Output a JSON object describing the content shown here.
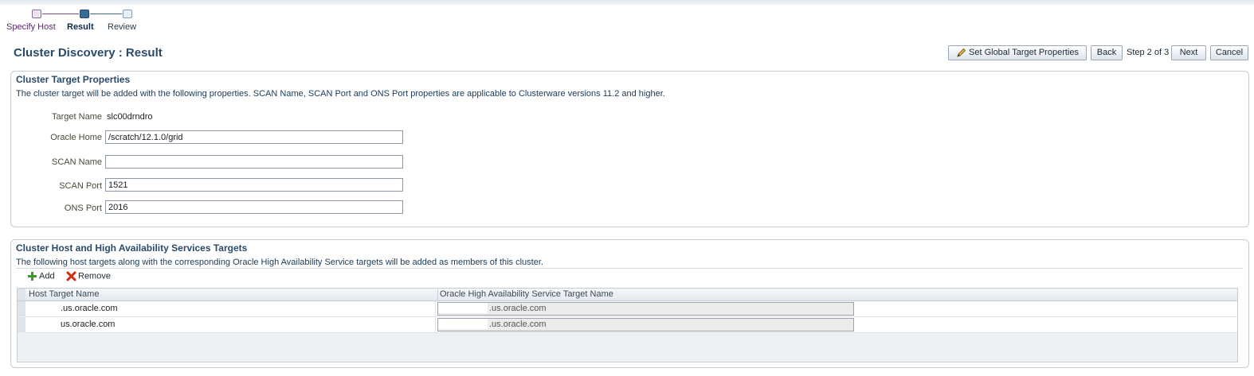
{
  "train": {
    "steps": [
      {
        "label": "Specify Host"
      },
      {
        "label": "Result"
      },
      {
        "label": "Review"
      }
    ]
  },
  "page": {
    "title": "Cluster Discovery : Result"
  },
  "toolbar": {
    "set_global_label": "Set Global Target Properties",
    "back_label": "Back",
    "step_text": "Step 2 of 3",
    "next_label": "Next",
    "cancel_label": "Cancel"
  },
  "cluster_target": {
    "heading": "Cluster Target Properties",
    "description": "The cluster target will be added with the following properties. SCAN Name, SCAN Port and ONS Port properties are applicable to Clusterware versions 11.2 and higher.",
    "fields": {
      "target_name": {
        "label": "Target Name",
        "value": "slc00drndro"
      },
      "oracle_home": {
        "label": "Oracle Home",
        "value": "/scratch/12.1.0/grid"
      },
      "scan_name": {
        "label": "SCAN Name",
        "value": ""
      },
      "scan_port": {
        "label": "SCAN Port",
        "value": "1521"
      },
      "ons_port": {
        "label": "ONS Port",
        "value": "2016"
      }
    }
  },
  "host_targets": {
    "heading": "Cluster Host and High Availability Services Targets",
    "description": "The following host targets along with the corresponding Oracle High Availability Service targets will be added as members of this cluster.",
    "add_label": "Add",
    "remove_label": "Remove",
    "columns": [
      "Host Target Name",
      "Oracle High Availability Service Target Name"
    ],
    "rows": [
      {
        "host": ".us.oracle.com",
        "has": ".us.oracle.com"
      },
      {
        "host": "us.oracle.com",
        "has": ".us.oracle.com"
      }
    ]
  },
  "colors": {
    "heading": "#2a4a6a",
    "train_current": "#3b6a98",
    "train_visited": "#7b4a8c"
  }
}
